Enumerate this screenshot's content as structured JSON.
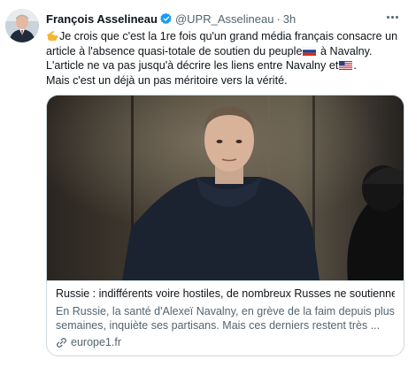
{
  "tweet": {
    "author_name": "François Asselineau",
    "handle": "@UPR_Asselineau",
    "separator": "·",
    "time": "3h",
    "lines": [
      {
        "before": "Je crois que c'est la 1re fois qu'un grand média français consacre un",
        "after": ""
      },
      {
        "before": "article à l'absence quasi-totale de soutien du peuple",
        "after": " à Navalny."
      },
      {
        "before": "L'article ne va pas jusqu'à décrire les liens entre Navalny et",
        "after": "."
      },
      {
        "before": "Mais c'est un déjà un pas méritoire vers la vérité.",
        "after": ""
      }
    ],
    "icons": {
      "avatar": "author-avatar",
      "verified": "verified-badge-icon",
      "more": "more-options-icon",
      "emoji_1": "pointing-hand-icon",
      "flag_1": "russia-flag-icon",
      "flag_2": "usa-flag-icon",
      "link": "link-icon"
    },
    "colors": {
      "verified_blue": "#1d9bf0",
      "secondary_text": "#536471",
      "border": "#cfd9de"
    }
  },
  "card": {
    "title": "Russie : indifférents voire hostiles, de nombreux Russes ne soutiennent ...",
    "description_lines": [
      "En Russie, la santé d'Alexeï Navalny, en grève de la faim depuis plusieurs",
      "semaines, inquiète ses partisans. Mais ces derniers restent très ..."
    ],
    "domain": "europe1.fr"
  }
}
